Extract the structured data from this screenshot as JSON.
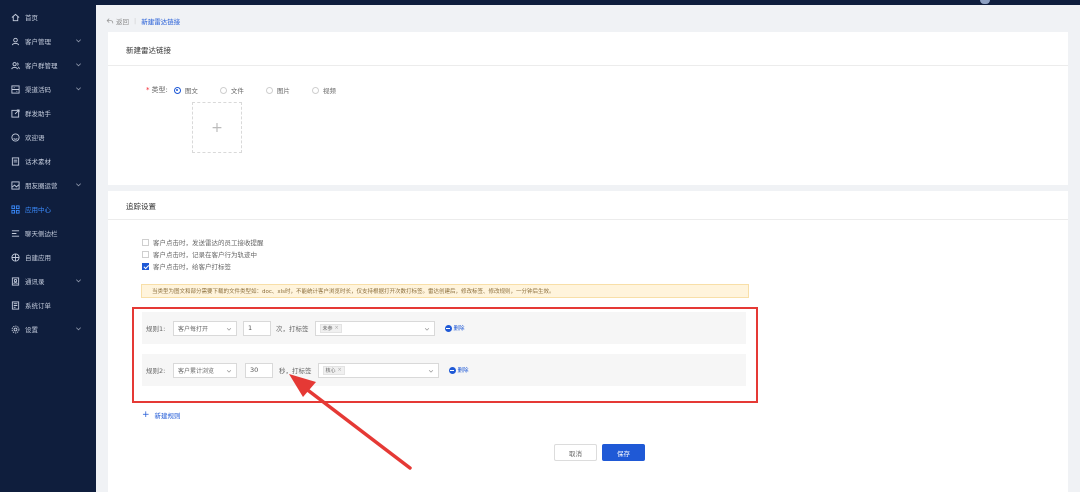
{
  "sidebar": {
    "items": [
      {
        "label": "首页",
        "icon": "home-icon",
        "has_children": false,
        "active": false
      },
      {
        "label": "客户管理",
        "icon": "user-icon",
        "has_children": true,
        "active": false
      },
      {
        "label": "客户群管理",
        "icon": "users-icon",
        "has_children": true,
        "active": false
      },
      {
        "label": "渠道活码",
        "icon": "qrcode-icon",
        "has_children": true,
        "active": false
      },
      {
        "label": "群发助手",
        "icon": "send-icon",
        "has_children": false,
        "active": false
      },
      {
        "label": "欢迎语",
        "icon": "smile-icon",
        "has_children": false,
        "active": false
      },
      {
        "label": "话术素材",
        "icon": "doc-icon",
        "has_children": false,
        "active": false
      },
      {
        "label": "朋友圈运营",
        "icon": "image-icon",
        "has_children": true,
        "active": false
      },
      {
        "label": "应用中心",
        "icon": "grid-icon",
        "has_children": false,
        "active": true
      },
      {
        "label": "聊天侧边栏",
        "icon": "sidebar-icon",
        "has_children": false,
        "active": false
      },
      {
        "label": "自建应用",
        "icon": "cube-icon",
        "has_children": false,
        "active": false
      },
      {
        "label": "通讯录",
        "icon": "contacts-icon",
        "has_children": true,
        "active": false
      },
      {
        "label": "系统订单",
        "icon": "order-icon",
        "has_children": false,
        "active": false
      },
      {
        "label": "设置",
        "icon": "gear-icon",
        "has_children": true,
        "active": false
      }
    ]
  },
  "breadcrumb": {
    "back": "返回",
    "current": "新建雷达链接"
  },
  "card1": {
    "title": "新建雷达链接",
    "type_label": "类型:",
    "types": [
      {
        "label": "图文",
        "selected": true
      },
      {
        "label": "文件",
        "selected": false
      },
      {
        "label": "图片",
        "selected": false
      },
      {
        "label": "视频",
        "selected": false
      }
    ],
    "upload_plus": "+"
  },
  "card2": {
    "title": "追踪设置",
    "options": [
      {
        "label": "客户点击时，发送雷达的员工接收提醒",
        "checked": false
      },
      {
        "label": "客户点击时，记录在客户行为轨迹中",
        "checked": false
      },
      {
        "label": "客户点击时，给客户打标签",
        "checked": true
      }
    ],
    "notice": "当类型为图文和部分需要下载的文件类型如：doc、xls时，不能统计客户浏览时长，仅支持根据打开次数打标签。雷达创建后，修改标签、修改规则，一分钟后生效。",
    "rules": [
      {
        "label": "规则1:",
        "condition": "客户每打开",
        "value": "1",
        "unit": "次，打标签",
        "tag": "未参",
        "tag_remove": "×",
        "delete_label": "删除"
      },
      {
        "label": "规则2:",
        "condition": "客户累计浏览",
        "value": "30",
        "unit": "秒，打标签",
        "tag": "核心",
        "tag_remove": "×",
        "delete_label": "删除"
      }
    ],
    "add_rule": "新建规则",
    "add_rule_plus": "+",
    "cancel": "取消",
    "save": "保存"
  },
  "colors": {
    "accent": "#1f59d6",
    "sidebar_bg": "#0f1e3d",
    "highlight_red": "#e53935"
  }
}
